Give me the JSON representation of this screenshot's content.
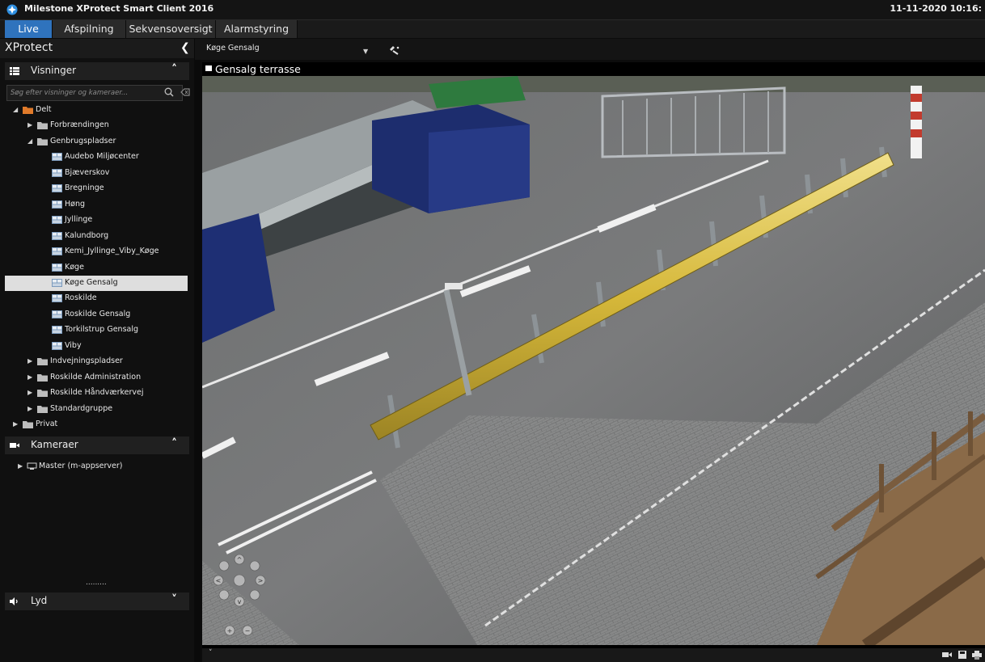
{
  "app": {
    "title": "Milestone XProtect Smart Client 2016",
    "clock": "11-11-2020 10:16:"
  },
  "tabs": [
    {
      "label": "Live",
      "active": true
    },
    {
      "label": "Afspilning",
      "active": false
    },
    {
      "label": "Sekvensoversigt",
      "active": false
    },
    {
      "label": "Alarmstyring",
      "active": false
    }
  ],
  "panel": {
    "title": "XProtect",
    "views_section": "Visninger",
    "search_placeholder": "Søg efter visninger og kameraer...",
    "cameras_section": "Kameraer",
    "audio_section": "Lyd",
    "splitter_dots": "........."
  },
  "tree": [
    {
      "label": "Delt",
      "type": "folder",
      "expanded": true
    },
    {
      "label": "Forbrændingen",
      "type": "folder",
      "expanded": false
    },
    {
      "label": "Genbrugspladser",
      "type": "folder",
      "expanded": true
    },
    {
      "label": "Audebo Miljøcenter",
      "type": "view"
    },
    {
      "label": "Bjæverskov",
      "type": "view"
    },
    {
      "label": "Bregninge",
      "type": "view"
    },
    {
      "label": "Høng",
      "type": "view"
    },
    {
      "label": "Jyllinge",
      "type": "view"
    },
    {
      "label": "Kalundborg",
      "type": "view"
    },
    {
      "label": "Kemi_Jyllinge_Viby_Køge",
      "type": "view"
    },
    {
      "label": "Køge",
      "type": "view"
    },
    {
      "label": "Køge Gensalg",
      "type": "view",
      "selected": true
    },
    {
      "label": "Roskilde",
      "type": "view"
    },
    {
      "label": "Roskilde Gensalg",
      "type": "view"
    },
    {
      "label": "Torkilstrup Gensalg",
      "type": "view"
    },
    {
      "label": "Viby",
      "type": "view"
    },
    {
      "label": "Indvejningspladser",
      "type": "folder",
      "expanded": false
    },
    {
      "label": "Roskilde Administration",
      "type": "folder",
      "expanded": false
    },
    {
      "label": "Roskilde Håndværkervej",
      "type": "folder",
      "expanded": false
    },
    {
      "label": "Standardgruppe",
      "type": "folder",
      "expanded": false
    },
    {
      "label": "Privat",
      "type": "folder",
      "expanded": false
    }
  ],
  "cameras_tree": [
    {
      "label": "Master (m-appserver)"
    }
  ],
  "view": {
    "name": "Køge Gensalg",
    "camera_title": "Gensalg terrasse"
  },
  "colors": {
    "accent": "#2f73bd",
    "selected_row": "#dedede",
    "background": "#0c0c0c"
  }
}
